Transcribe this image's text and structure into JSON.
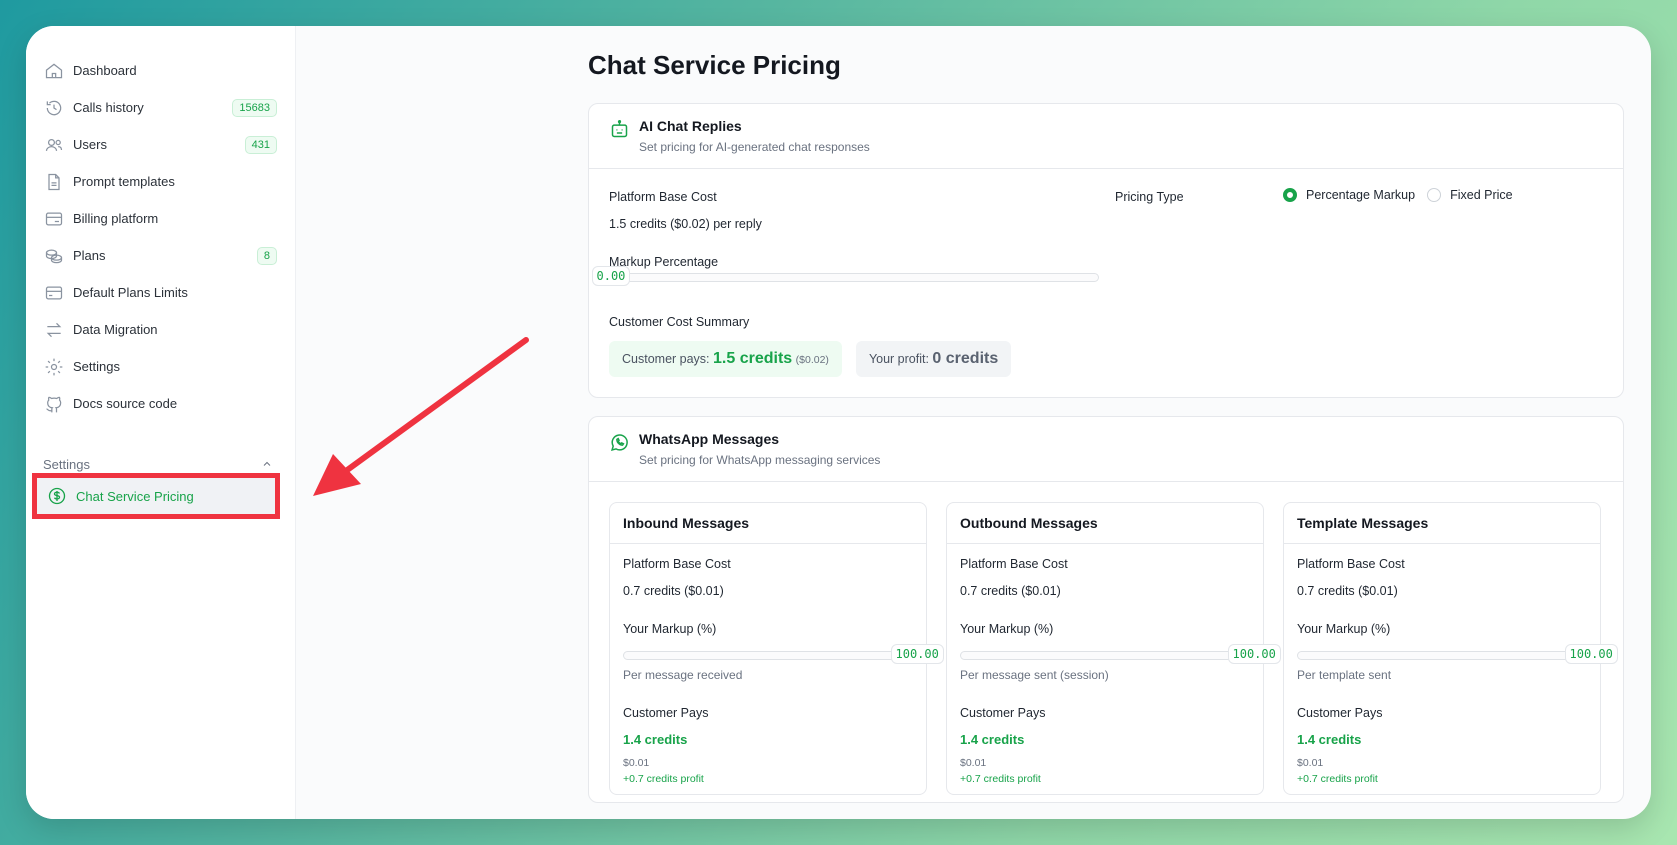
{
  "sidebar": {
    "items": [
      {
        "label": "Dashboard",
        "icon": "home-icon"
      },
      {
        "label": "Calls history",
        "icon": "history-icon",
        "badge": "15683"
      },
      {
        "label": "Users",
        "icon": "users-icon",
        "badge": "431"
      },
      {
        "label": "Prompt templates",
        "icon": "document-icon"
      },
      {
        "label": "Billing platform",
        "icon": "billing-icon"
      },
      {
        "label": "Plans",
        "icon": "coins-icon",
        "badge": "8"
      },
      {
        "label": "Default Plans Limits",
        "icon": "credit-card-icon"
      },
      {
        "label": "Data Migration",
        "icon": "arrows-swap-icon"
      },
      {
        "label": "Settings",
        "icon": "gear-icon"
      },
      {
        "label": "Docs source code",
        "icon": "github-icon"
      }
    ],
    "section_label": "Settings",
    "active_item": "Chat Service Pricing"
  },
  "page": {
    "title": "Chat Service Pricing"
  },
  "ai_card": {
    "title": "AI Chat Replies",
    "subtitle": "Set pricing for AI-generated chat responses",
    "base_cost_label": "Platform Base Cost",
    "base_cost_value": "1.5 credits ($0.02) per reply",
    "markup_label": "Markup Percentage",
    "markup_value": "0.00",
    "markup_fraction": 0.0,
    "summary_label": "Customer Cost Summary",
    "customer_pays_label": "Customer pays:",
    "customer_pays_credits": "1.5 credits",
    "customer_pays_usd": "($0.02)",
    "profit_label": "Your profit:",
    "profit_value": "0 credits",
    "pricing_type_label": "Pricing Type",
    "option_percentage": "Percentage Markup",
    "option_fixed": "Fixed Price",
    "selected_option": "Percentage Markup"
  },
  "wa_card": {
    "title": "WhatsApp Messages",
    "subtitle": "Set pricing for WhatsApp messaging services",
    "columns": [
      {
        "title": "Inbound Messages",
        "base_cost_label": "Platform Base Cost",
        "base_cost_value": "0.7 credits ($0.01)",
        "markup_label": "Your Markup (%)",
        "markup_value": "100.00",
        "markup_fraction": 1.0,
        "note": "Per message received",
        "pays_label": "Customer Pays",
        "pays_credits": "1.4 credits",
        "pays_usd": "$0.01",
        "profit": "+0.7 credits profit"
      },
      {
        "title": "Outbound Messages",
        "base_cost_label": "Platform Base Cost",
        "base_cost_value": "0.7 credits ($0.01)",
        "markup_label": "Your Markup (%)",
        "markup_value": "100.00",
        "markup_fraction": 1.0,
        "note": "Per message sent (session)",
        "pays_label": "Customer Pays",
        "pays_credits": "1.4 credits",
        "pays_usd": "$0.01",
        "profit": "+0.7 credits profit"
      },
      {
        "title": "Template Messages",
        "base_cost_label": "Platform Base Cost",
        "base_cost_value": "0.7 credits ($0.01)",
        "markup_label": "Your Markup (%)",
        "markup_value": "100.00",
        "markup_fraction": 1.0,
        "note": "Per template sent",
        "pays_label": "Customer Pays",
        "pays_credits": "1.4 credits",
        "pays_usd": "$0.01",
        "profit": "+0.7 credits profit"
      }
    ]
  },
  "colors": {
    "accent": "#18a34a",
    "highlight": "#ef3340"
  }
}
